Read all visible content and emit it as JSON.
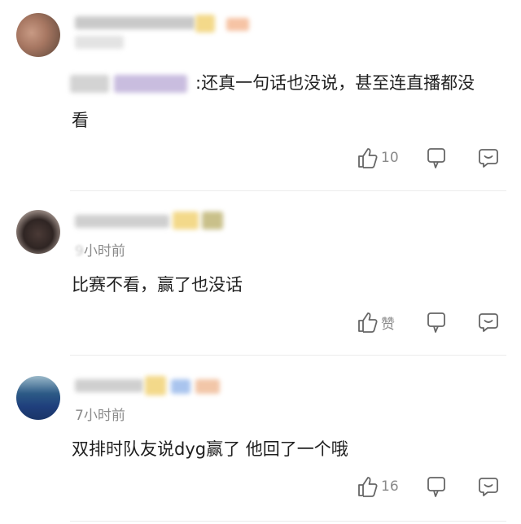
{
  "comments": [
    {
      "time": "",
      "quote_suffix": ":",
      "text": "还真一句话也没说，甚至连直播都没",
      "text_line2": "看",
      "likes": "10"
    },
    {
      "time": "小时前",
      "time_prefix_blurred": "9",
      "text": "比赛不看，赢了也没话",
      "likes": "赞"
    },
    {
      "time": "7小时前",
      "text": "双排时队友说dyg赢了 他回了一个哦",
      "likes": "16"
    }
  ],
  "icons": {
    "like": "thumbs-up-icon",
    "dislike": "thumbs-down-icon",
    "reply": "chat-bubble-smile-icon"
  },
  "colors": {
    "text": "#1f1f1f",
    "meta": "#8a8a8a",
    "divider": "#ececec"
  }
}
